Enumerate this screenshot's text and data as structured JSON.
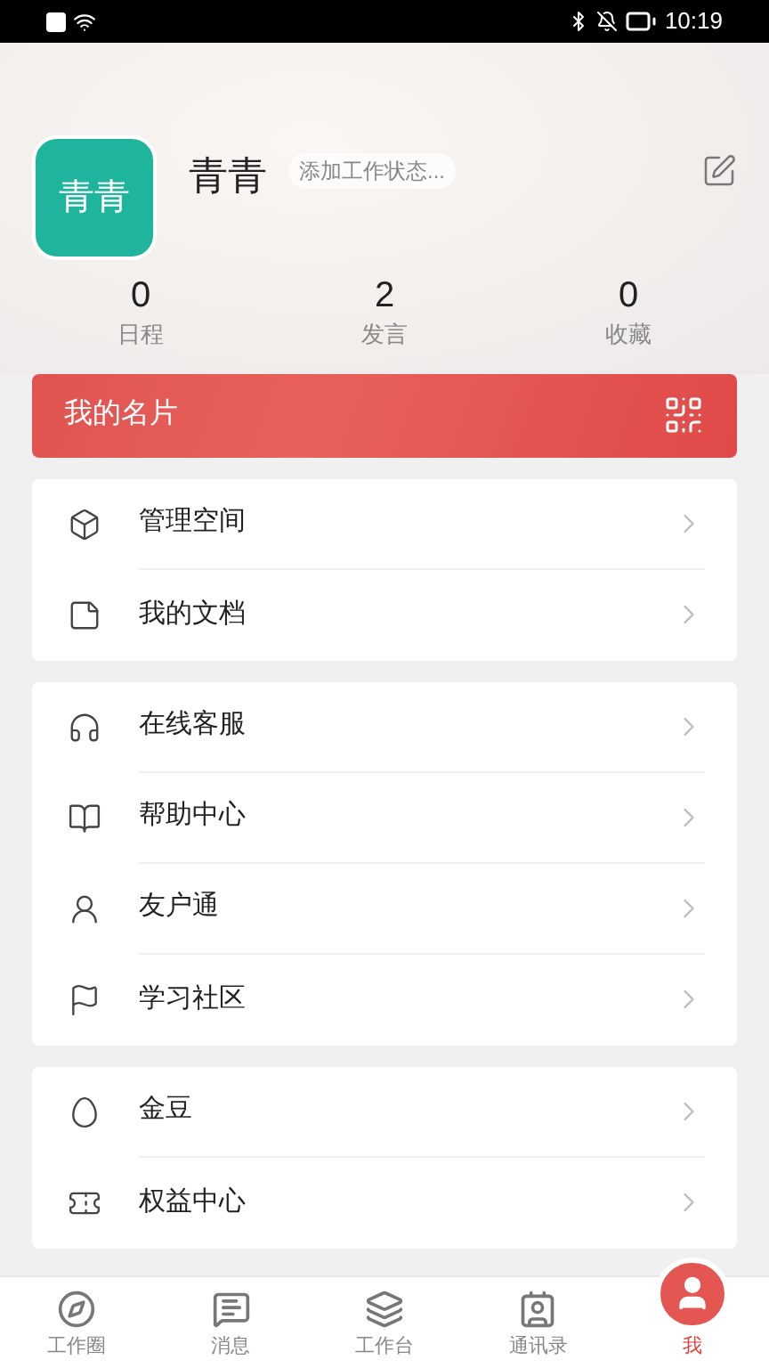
{
  "status_bar": {
    "time": "10:19"
  },
  "profile": {
    "avatar_text": "青青",
    "name": "青青",
    "status_placeholder": "添加工作状态..."
  },
  "stats": [
    {
      "value": "0",
      "label": "日程"
    },
    {
      "value": "2",
      "label": "发言"
    },
    {
      "value": "0",
      "label": "收藏"
    }
  ],
  "card_banner": {
    "label": "我的名片"
  },
  "menu_groups": [
    [
      {
        "label": "管理空间"
      },
      {
        "label": "我的文档"
      }
    ],
    [
      {
        "label": "在线客服"
      },
      {
        "label": "帮助中心"
      },
      {
        "label": "友户通"
      },
      {
        "label": "学习社区"
      }
    ],
    [
      {
        "label": "金豆"
      },
      {
        "label": "权益中心"
      }
    ]
  ],
  "tabs": [
    {
      "label": "工作圈",
      "selected": false
    },
    {
      "label": "消息",
      "selected": false
    },
    {
      "label": "工作台",
      "selected": false
    },
    {
      "label": "通讯录",
      "selected": false
    },
    {
      "label": "我",
      "selected": true
    }
  ]
}
